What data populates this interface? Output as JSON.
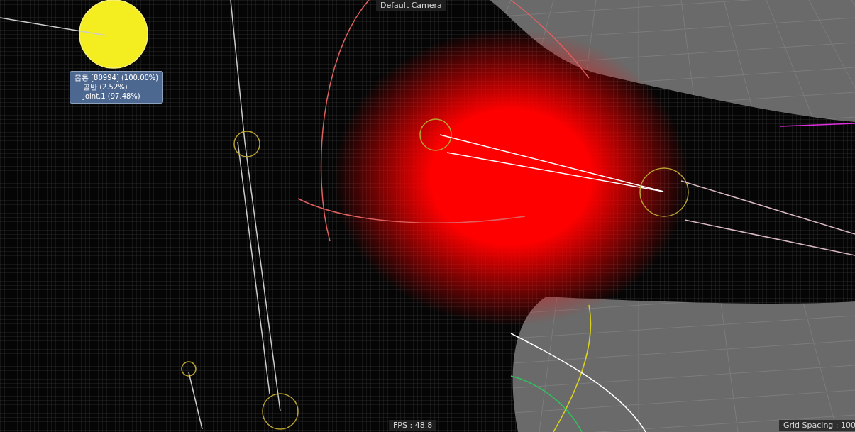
{
  "viewport": {
    "camera_label": "Default Camera",
    "fps": "FPS : 48.8",
    "grid_spacing": "Grid Spacing : 100"
  },
  "tooltip": {
    "text": "몸통 [80994] (100.00%)",
    "children": [
      {
        "text": "골반 (2.52%)"
      },
      {
        "text": "Joint.1 (97.48%)"
      }
    ]
  }
}
